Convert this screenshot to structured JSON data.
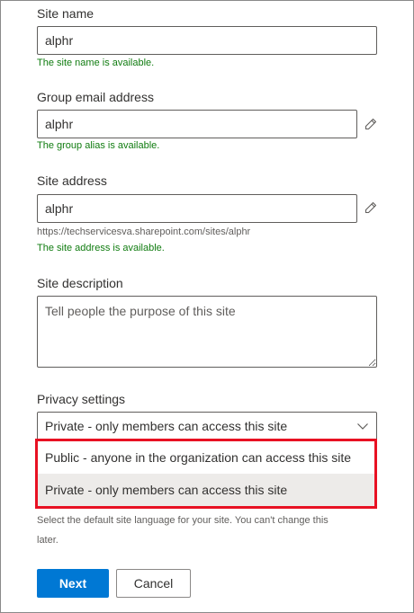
{
  "site_name": {
    "label": "Site name",
    "value": "alphr",
    "status": "The site name is available."
  },
  "group_email": {
    "label": "Group email address",
    "value": "alphr",
    "status": "The group alias is available.",
    "edit_icon": "pencil-icon"
  },
  "site_address": {
    "label": "Site address",
    "value": "alphr",
    "url": "https://techservicesva.sharepoint.com/sites/alphr",
    "status": "The site address is available.",
    "edit_icon": "pencil-icon"
  },
  "site_description": {
    "label": "Site description",
    "placeholder": "Tell people the purpose of this site"
  },
  "privacy": {
    "label": "Privacy settings",
    "selected": "Private - only members can access this site",
    "dropdown_icon": "chevron-down-icon",
    "options": [
      "Public - anyone in the organization can access this site",
      "Private - only members can access this site"
    ],
    "highlight_color": "#e81123"
  },
  "language_hint": {
    "line1": "Select the default site language for your site. You can't change this",
    "line2": "later."
  },
  "actions": {
    "next_label": "Next",
    "cancel_label": "Cancel",
    "primary_color": "#0078d4"
  }
}
